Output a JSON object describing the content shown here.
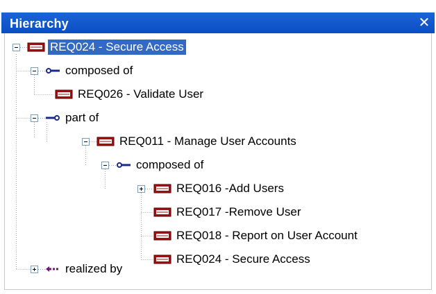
{
  "panel": {
    "title": "Hierarchy",
    "close_glyph": "✕"
  },
  "tree": {
    "nodes": [
      {
        "label": "REQ024 - Secure Access",
        "icon": "requirement-icon",
        "expander": "minus",
        "selected": true
      },
      {
        "label": "composed of",
        "icon": "composed-of-icon",
        "expander": "minus"
      },
      {
        "label": "REQ026 - Validate User",
        "icon": "requirement-icon"
      },
      {
        "label": "part of",
        "icon": "part-of-icon",
        "expander": "minus"
      },
      {
        "label": "REQ011 - Manage User Accounts",
        "icon": "requirement-icon",
        "expander": "minus"
      },
      {
        "label": "composed of",
        "icon": "composed-of-icon",
        "expander": "minus"
      },
      {
        "label": "REQ016 -Add Users",
        "icon": "requirement-icon",
        "expander": "plus"
      },
      {
        "label": "REQ017 -Remove User",
        "icon": "requirement-icon"
      },
      {
        "label": "REQ018 - Report on User Account",
        "icon": "requirement-icon"
      },
      {
        "label": "REQ024 - Secure Access",
        "icon": "requirement-icon"
      },
      {
        "label": "realized by",
        "icon": "realized-by-icon",
        "expander": "plus"
      }
    ]
  },
  "colors": {
    "titlebar": "#0a4ec4",
    "selection": "#316ac5",
    "requirement_icon": "#a01010",
    "connector_blue": "#1a2a8c",
    "connector_purple": "#6a1a6a"
  }
}
